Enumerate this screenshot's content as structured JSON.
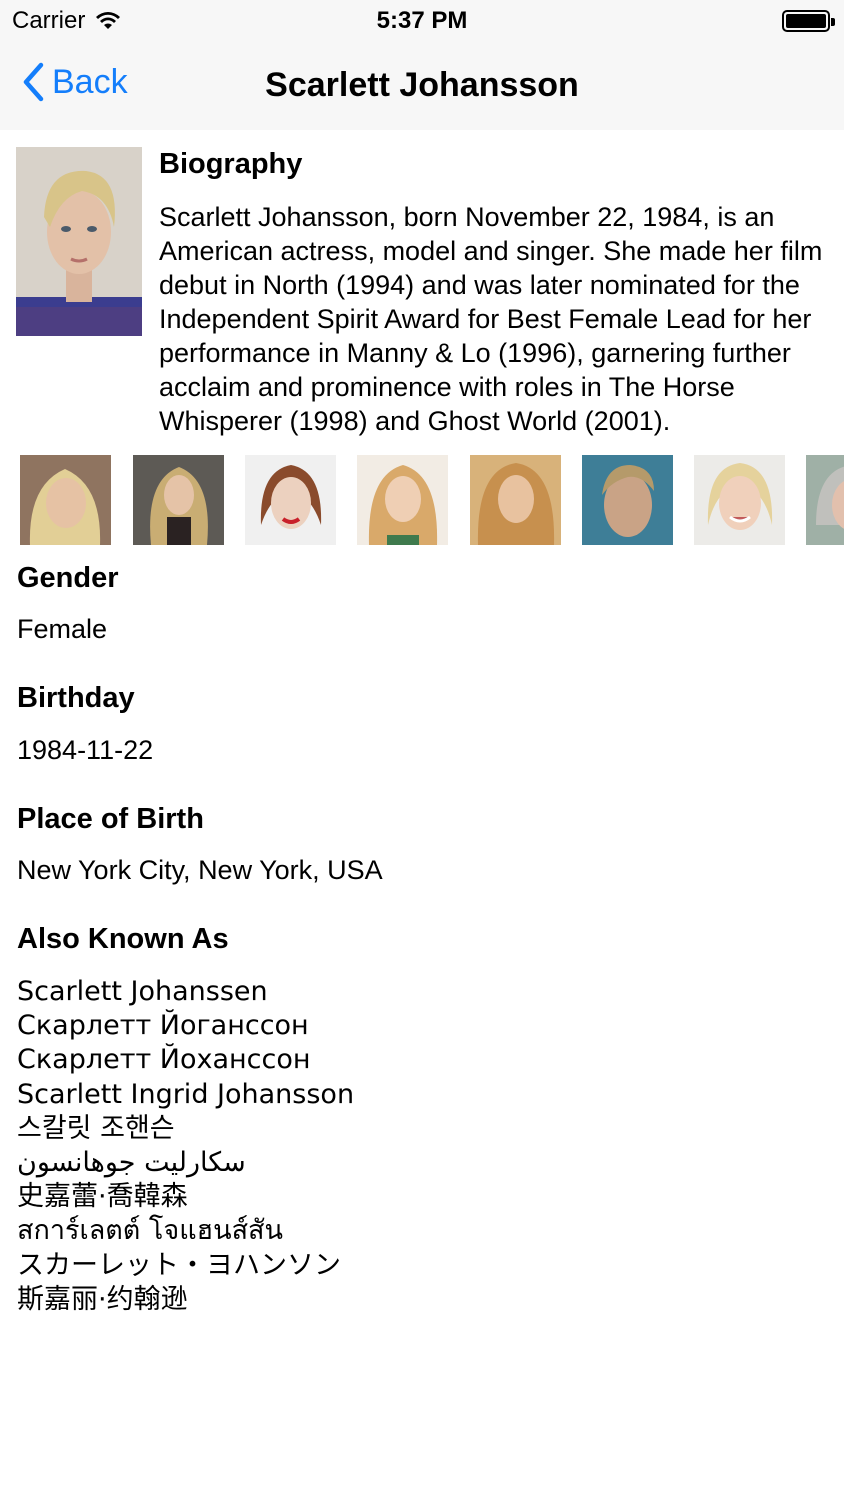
{
  "status_bar": {
    "carrier": "Carrier",
    "time": "5:37 PM"
  },
  "nav": {
    "back_label": "Back",
    "title": "Scarlett Johansson"
  },
  "biography": {
    "heading": "Biography",
    "text": "Scarlett Johansson, born November 22, 1984, is an American actress, model and singer. She made her film debut in North (1994) and was later nominated for the Independent Spirit Award for Best Female Lead for her performance in Manny & Lo (1996), garnering further acclaim and prominence with roles in The Horse Whisperer (1998) and Ghost World (2001)."
  },
  "gender": {
    "heading": "Gender",
    "value": "Female"
  },
  "birthday": {
    "heading": "Birthday",
    "value": "1984-11-22"
  },
  "place_of_birth": {
    "heading": "Place of Birth",
    "value": "New York City, New York, USA"
  },
  "also_known_as": {
    "heading": "Also Known As",
    "names": [
      "Scarlett Johanssen",
      "Скарлетт Йоганссон",
      "Скарлетт Йоханссон",
      "Scarlett Ingrid Johansson",
      "스칼릿 조핸슨",
      "سكارليت جوهانسون",
      "史嘉蕾·喬韓森",
      "สการ์เลตต์ โจแฮนส์สัน",
      "スカーレット・ヨハンソン",
      "斯嘉丽·约翰逊"
    ]
  },
  "colors": {
    "accent": "#147efb",
    "bar_background": "#f7f7f7"
  }
}
